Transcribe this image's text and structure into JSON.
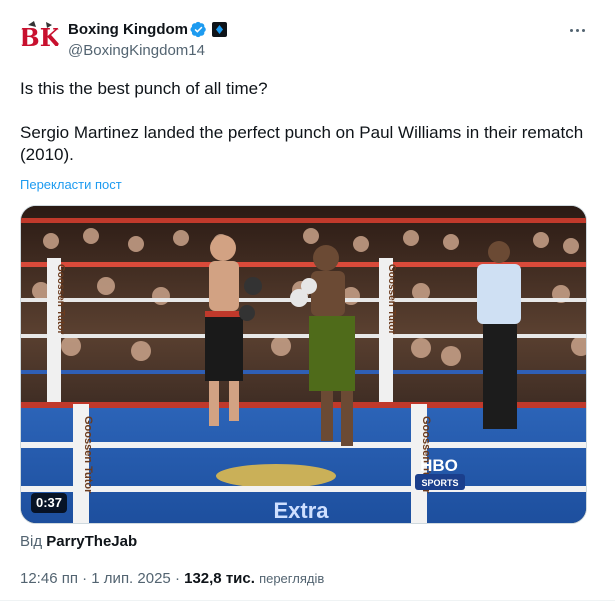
{
  "author": {
    "name": "Boxing Kingdom",
    "handle": "@BoxingKingdom14",
    "avatar_text": "BK",
    "verified_color": "#1d9bf0"
  },
  "tweet": {
    "line1": "Is this the best punch of all time?",
    "line2": "Sergio Martinez landed the perfect punch on Paul Williams in their rematch (2010).",
    "translate_label": "Перекласти пост"
  },
  "media": {
    "duration": "0:37",
    "ring_text": "Goossen Tutor",
    "logo_top": "HBO",
    "logo_bottom": "SPORTS",
    "canvas_text": "Extra"
  },
  "source": {
    "prefix": "Від",
    "user": "ParryTheJab"
  },
  "meta": {
    "time": "12:46 пп",
    "separator": "·",
    "date": "1 лип. 2025",
    "views": "132,8 тис.",
    "views_label": "переглядів"
  },
  "icons": {
    "more": "more-horizontal-icon",
    "verified": "verified-badge-icon",
    "affiliate": "affiliate-badge-icon"
  }
}
